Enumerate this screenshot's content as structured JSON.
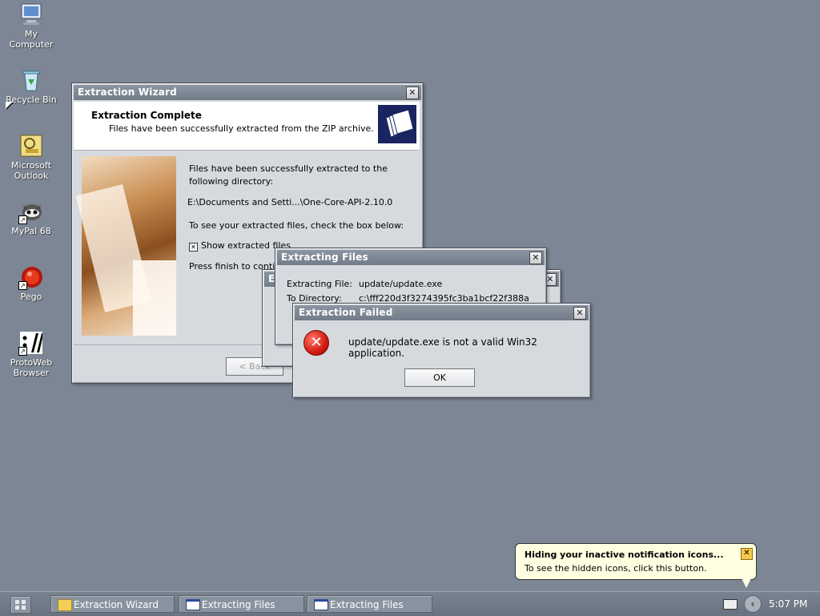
{
  "desktop": {
    "icons": [
      {
        "label": "My Computer",
        "icon": "computer-icon"
      },
      {
        "label": "Recycle Bin",
        "icon": "recycle-bin-icon"
      },
      {
        "label": "Microsoft Outlook",
        "icon": "outlook-icon"
      },
      {
        "label": "MyPal 68",
        "icon": "mypal-icon"
      },
      {
        "label": "Pego",
        "icon": "pego-icon"
      },
      {
        "label": "ProtoWeb Browser",
        "icon": "protoweb-icon"
      }
    ]
  },
  "wizard": {
    "title": "Extraction Wizard",
    "header_title": "Extraction Complete",
    "header_subtitle": "Files have been successfully extracted from the ZIP archive.",
    "line1": "Files have been successfully extracted to the following directory:",
    "path": "E:\\Documents and Setti...\\One-Core-API-2.10.0",
    "line2": "To see your extracted files, check the box below:",
    "checkbox_label": "Show extracted files",
    "line3": "Press finish to continue.",
    "back_label": "< Back"
  },
  "extracting": {
    "title": "Extracting Files",
    "file_label": "Extracting File:",
    "file_value": "update/update.exe",
    "dir_label": "To Directory:",
    "dir_value": "c:\\fff220d3f3274395fc3ba1bcf22f388a"
  },
  "failed": {
    "title": "Extraction Failed",
    "message": "update/update.exe is not a valid Win32 application.",
    "ok_label": "OK"
  },
  "taskbar": {
    "tasks": [
      {
        "label": "Extraction Wizard",
        "icon": "folder-icon"
      },
      {
        "label": "Extracting Files",
        "icon": "window-icon"
      },
      {
        "label": "Extracting Files",
        "icon": "window-icon"
      }
    ],
    "clock": "5:07 PM"
  },
  "balloon": {
    "title": "Hiding your inactive notification icons...",
    "body": "To see the hidden icons, click this button."
  },
  "colors": {
    "desktop": "#7c8694",
    "titlebar": "#7c8591",
    "error_red": "#d31a12"
  }
}
